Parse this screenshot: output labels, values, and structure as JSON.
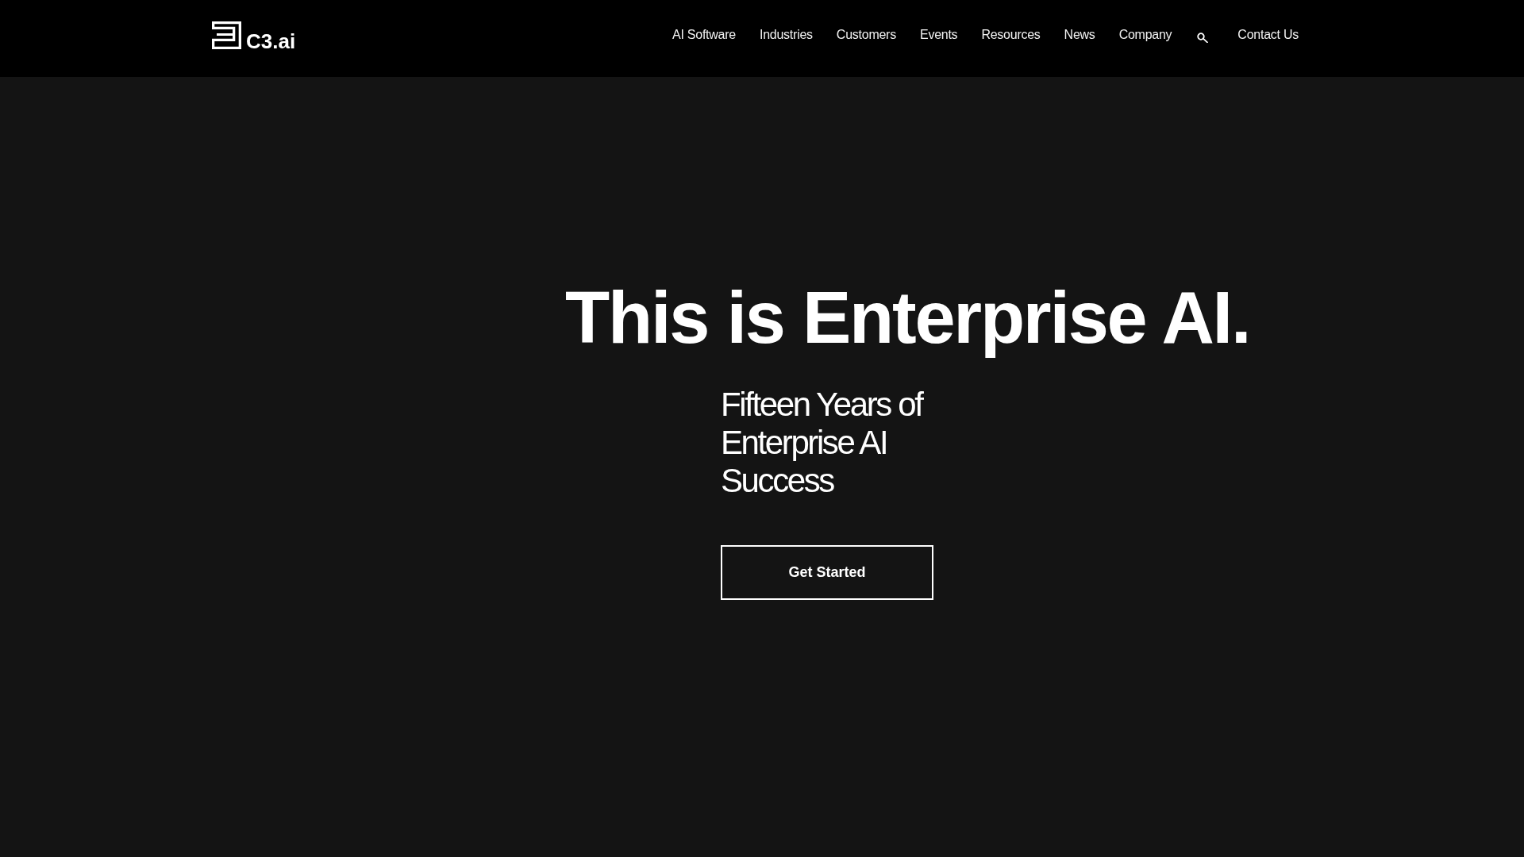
{
  "header": {
    "logo": {
      "text": "C3.ai"
    },
    "nav": [
      "AI Software",
      "Industries",
      "Customers",
      "Events",
      "Resources",
      "News",
      "Company"
    ],
    "contact": "Contact Us"
  },
  "hero": {
    "title": "This is Enterprise AI.",
    "subtitle": "Fifteen Years of Enterprise AI Success",
    "button": "Get Started"
  }
}
